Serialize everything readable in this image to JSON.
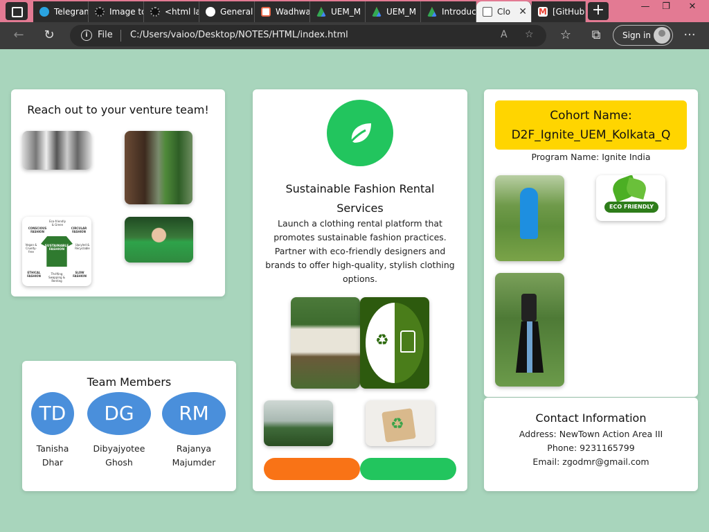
{
  "browser": {
    "tabs": [
      {
        "label": "Telegram",
        "color": "#2aa3e0"
      },
      {
        "label": "Image to",
        "color": "#555555"
      },
      {
        "label": "<html la",
        "color": "#555555"
      },
      {
        "label": "General",
        "color": "#ffffff"
      },
      {
        "label": "Wadhwa",
        "color": "#e8684a"
      },
      {
        "label": "UEM_M",
        "color": "#4caf50"
      },
      {
        "label": "UEM_M",
        "color": "#4caf50"
      },
      {
        "label": "Introduc",
        "color": "#fbbc04"
      },
      {
        "label": "Clo",
        "color": "#ffffff"
      },
      {
        "label": "[GitHub",
        "color": "#ea4335"
      }
    ],
    "new_tab": "+",
    "scheme": "File",
    "url": "C:/Users/vaioo/Desktop/NOTES/HTML/index.html",
    "sign_in": "Sign in",
    "menu": "···"
  },
  "venture": {
    "title": "Reach out to your venture team!"
  },
  "team": {
    "title": "Team Members",
    "members": [
      {
        "initials": "TD",
        "first": "Tanisha",
        "last": "Dhar"
      },
      {
        "initials": "DG",
        "first": "Dibyajyotee",
        "last": "Ghosh"
      },
      {
        "initials": "RM",
        "first": "Rajanya",
        "last": "Majumder"
      }
    ]
  },
  "idea": {
    "title_line1": "Sustainable Fashion Rental",
    "title_line2": "Services",
    "desc_lines": [
      "Launch a clothing rental platform that",
      "promotes sustainable fashion practices.",
      "Partner with eco-friendly designers and",
      "brands to offer high-quality, stylish clothing",
      "options."
    ],
    "icon": "leaf-icon",
    "accent": "#22c55e"
  },
  "infographic": {
    "center_line1": "SUSTAINABLE",
    "center_line2": "FASHION",
    "conscious": "CONSCIOUS FASHION",
    "eco": "Eco-friendly & Green",
    "circular": "CIRCULAR FASHION",
    "vegan": "Vegan & Cruelty-free",
    "upcycled": "Upcyled & Recyclable",
    "ethical": "ETHICAL FASHION",
    "thrifting": "Thrifting Swapping & Renting",
    "slow": "SLOW FASHION"
  },
  "buttons": {
    "primary_color": "#f97316",
    "secondary_color": "#22c55e"
  },
  "cohort": {
    "label": "Cohort Name:",
    "name": "D2F_Ignite_UEM_Kolkata_Q",
    "program": "Program Name: Ignite India",
    "badge_text": "ECO FRIENDLY",
    "highlight": "#ffd500"
  },
  "contact": {
    "title": "Contact Information",
    "address": "Address: NewTown Action Area III",
    "phone": "Phone: 9231165799",
    "email": "Email: zgodmr@gmail.com"
  }
}
